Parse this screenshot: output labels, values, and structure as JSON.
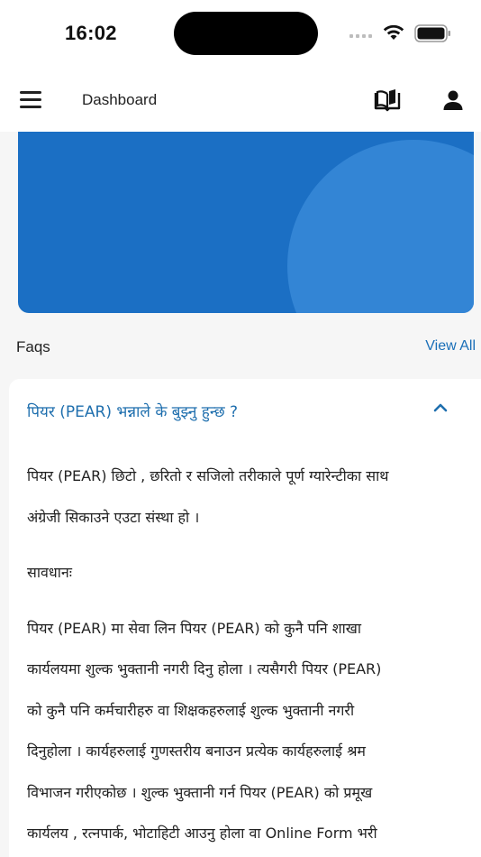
{
  "status_bar": {
    "time": "16:02"
  },
  "app_bar": {
    "title": "Dashboard",
    "menu_icon": "menu-icon",
    "book_icon": "book-icon",
    "profile_icon": "person-icon"
  },
  "section": {
    "title": "Faqs",
    "view_all": "View All"
  },
  "faq": {
    "question": "पियर (PEAR) भन्नाले के बुझ्नु हुन्छ ?",
    "answer_p1_l1": "पियर (PEAR) छिटो , छरितो र सजिलो तरीकाले पूर्ण ग्यारेन्टीका साथ",
    "answer_p1_l2": "अंग्रेजी सिकाउने एउटा संस्था हो ।",
    "warning_label": "सावधानः",
    "answer_p2_l1": "पियर (PEAR) मा सेवा लिन पियर (PEAR) को कुनै पनि शाखा",
    "answer_p2_l2": "कार्यलयमा शुल्क भुक्तानी नगरी दिनु होला । त्यसैगरी पियर (PEAR)",
    "answer_p2_l3": "को कुनै पनि कर्मचारीहरु वा शिक्षकहरुलाई शुल्क भुक्तानी नगरी",
    "answer_p2_l4": "दिनुहोला । कार्यहरुलाई गुणस्तरीय बनाउन प्रत्येक कार्यहरुलाई श्रम",
    "answer_p2_l5": "विभाजन गरीएकोछ ।  शुल्क भुक्तानी गर्न पियर (PEAR) को प्रमूख",
    "answer_p2_l6": "कार्यलय , रत्नपार्क, भोटाहिटी आउनु होला वा Online Form भरी"
  },
  "colors": {
    "banner": "#1b6fc4",
    "accent": "#1f6fae",
    "link": "#1a6fb8"
  }
}
